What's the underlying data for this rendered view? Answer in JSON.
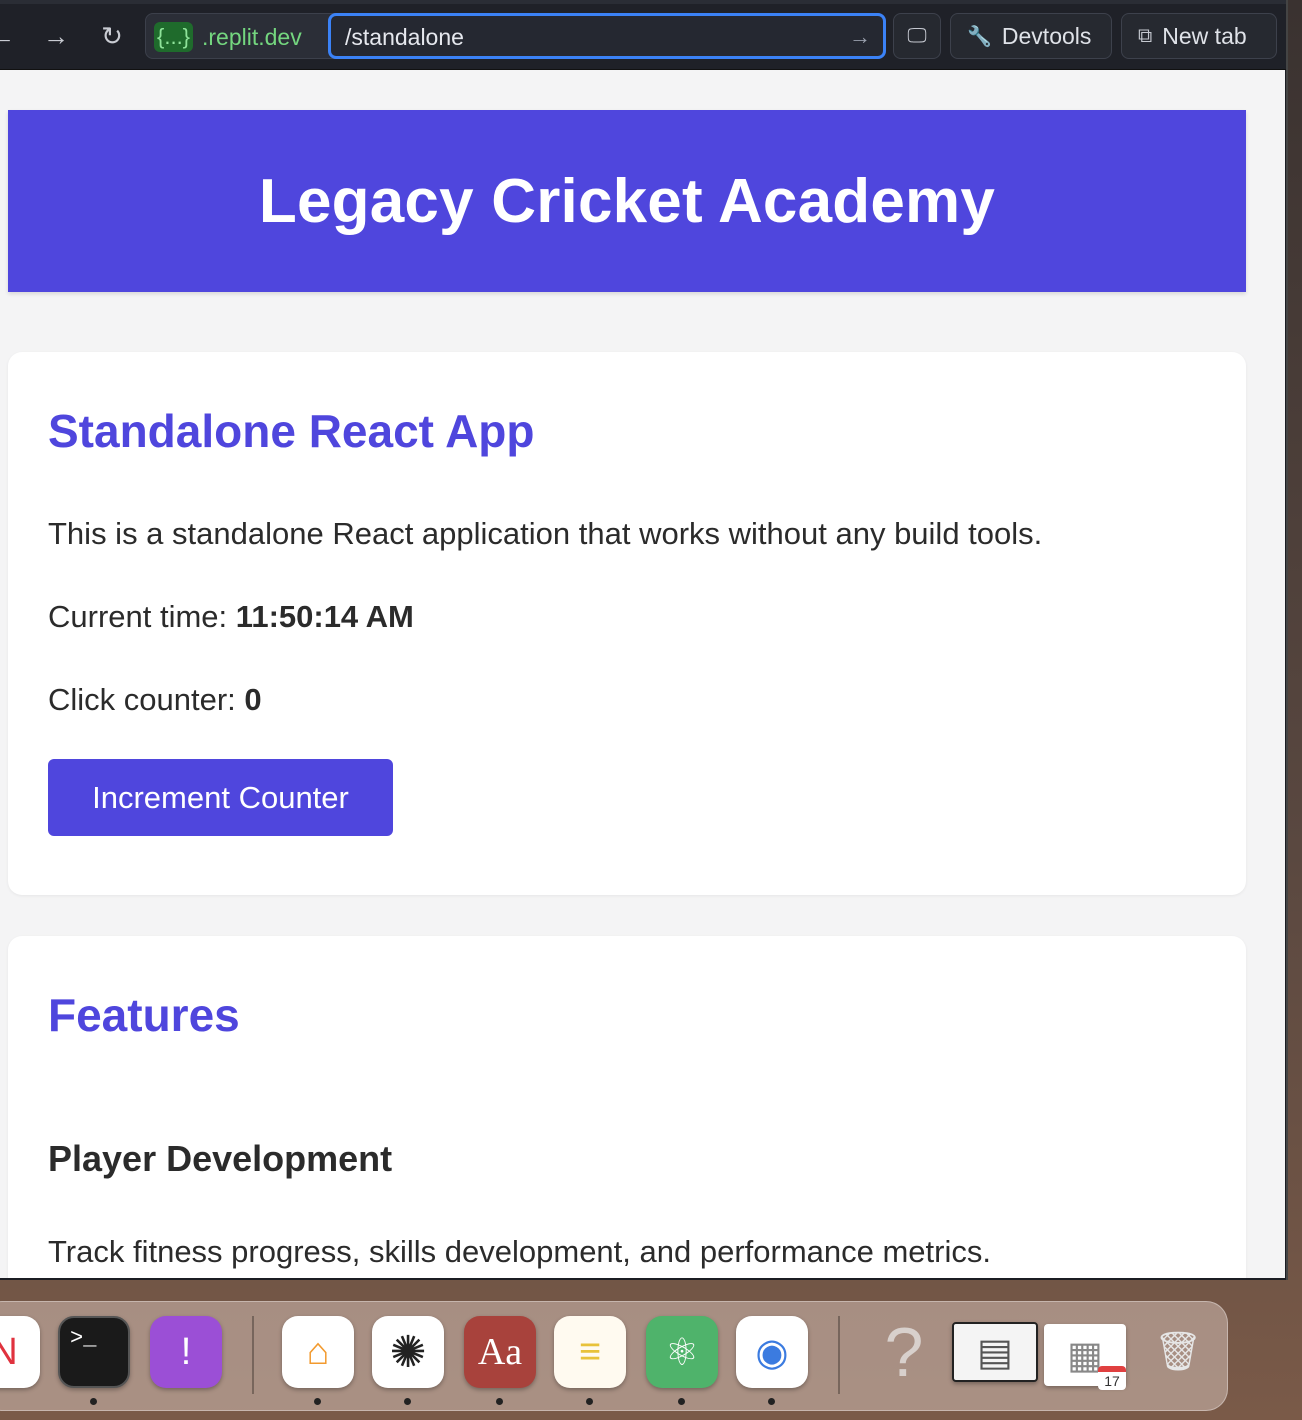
{
  "browser": {
    "domain_badge": "{...}",
    "domain": ".replit.dev",
    "path": "/standalone",
    "devtools_label": "Devtools",
    "newtab_label": "New tab"
  },
  "page": {
    "header_title": "Legacy Cricket Academy",
    "app_card": {
      "title": "Standalone React App",
      "description": "This is a standalone React application that works without any build tools.",
      "time_label": "Current time:",
      "time_value": "11:50:14 AM",
      "counter_label": "Click counter:",
      "counter_value": "0",
      "button_label": "Increment Counter"
    },
    "features_card": {
      "title": "Features",
      "items": [
        {
          "title": "Player Development",
          "description": "Track fitness progress, skills development, and performance metrics."
        }
      ]
    }
  },
  "dock": {
    "apps": [
      {
        "name": "news-app-icon",
        "glyph": "N",
        "bg": "#ffffff",
        "fg": "#e0323e"
      },
      {
        "name": "terminal-app-icon",
        "glyph": ">_",
        "bg": "#1a1a1a",
        "fg": "#ffffff"
      },
      {
        "name": "feedback-app-icon",
        "glyph": "!",
        "bg": "#9b4fd6",
        "fg": "#ffffff"
      },
      {
        "name": "home-app-icon",
        "glyph": "⌂",
        "bg": "#ffffff",
        "fg": "#f29a2e"
      },
      {
        "name": "chatgpt-app-icon",
        "glyph": "✺",
        "bg": "#ffffff",
        "fg": "#222222"
      },
      {
        "name": "dictionary-app-icon",
        "glyph": "Aa",
        "bg": "#a8423c",
        "fg": "#ffffff"
      },
      {
        "name": "notes-app-icon",
        "glyph": "≡",
        "bg": "#fffaf0",
        "fg": "#e8c23a"
      },
      {
        "name": "atom-app-icon",
        "glyph": "⚛",
        "bg": "#4fb36b",
        "fg": "#ffffff"
      },
      {
        "name": "chrome-app-icon",
        "glyph": "◉",
        "bg": "#ffffff",
        "fg": "#3b7be0"
      },
      {
        "name": "help-app-icon",
        "glyph": "?",
        "bg": "transparent",
        "fg": "#d8d0cc"
      },
      {
        "name": "screenshot-thumbnail-icon",
        "glyph": "▤",
        "bg": "#f4f4f4",
        "fg": "#555555"
      },
      {
        "name": "document-thumbnail-icon",
        "glyph": "▦",
        "bg": "#ffffff",
        "fg": "#888888"
      },
      {
        "name": "trash-icon",
        "glyph": "🗑",
        "bg": "transparent",
        "fg": "#e6e6e6"
      }
    ],
    "calendar_day": "17"
  }
}
